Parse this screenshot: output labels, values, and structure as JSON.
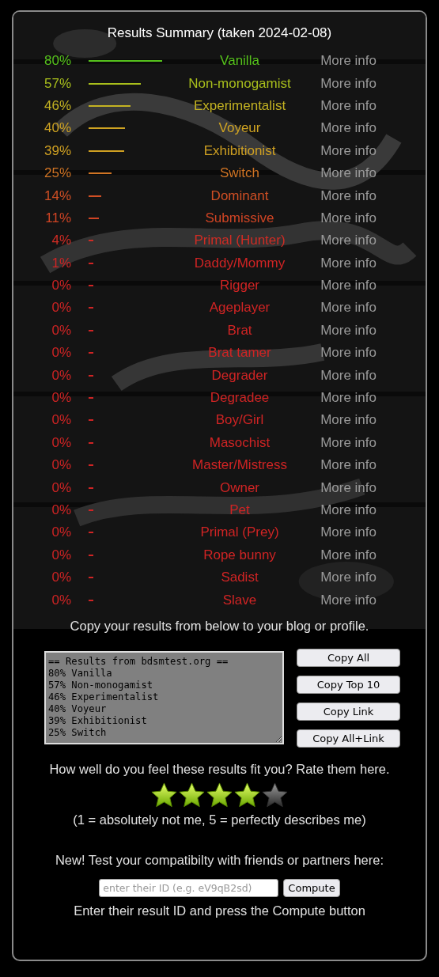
{
  "title": "Results Summary (taken 2024-02-08)",
  "results": [
    {
      "percent": "80%",
      "name": "Vanilla",
      "color": "#56c21c",
      "link": "More info"
    },
    {
      "percent": "57%",
      "name": "Non-monogamist",
      "color": "#a9bf1c",
      "link": "More info"
    },
    {
      "percent": "46%",
      "name": "Experimentalist",
      "color": "#c4b322",
      "link": "More info"
    },
    {
      "percent": "40%",
      "name": "Voyeur",
      "color": "#cfa322",
      "link": "More info"
    },
    {
      "percent": "39%",
      "name": "Exhibitionist",
      "color": "#cfa022",
      "link": "More info"
    },
    {
      "percent": "25%",
      "name": "Switch",
      "color": "#d07424",
      "link": "More info"
    },
    {
      "percent": "14%",
      "name": "Dominant",
      "color": "#d04f24",
      "link": "More info"
    },
    {
      "percent": "11%",
      "name": "Submissive",
      "color": "#d04424",
      "link": "More info"
    },
    {
      "percent": "4%",
      "name": "Primal (Hunter)",
      "color": "#d02c24",
      "link": "More info"
    },
    {
      "percent": "1%",
      "name": "Daddy/Mommy",
      "color": "#d02424",
      "link": "More info"
    },
    {
      "percent": "0%",
      "name": "Rigger",
      "color": "#d02424",
      "link": "More info"
    },
    {
      "percent": "0%",
      "name": "Ageplayer",
      "color": "#d02424",
      "link": "More info"
    },
    {
      "percent": "0%",
      "name": "Brat",
      "color": "#d02424",
      "link": "More info"
    },
    {
      "percent": "0%",
      "name": "Brat tamer",
      "color": "#d02424",
      "link": "More info"
    },
    {
      "percent": "0%",
      "name": "Degrader",
      "color": "#d02424",
      "link": "More info"
    },
    {
      "percent": "0%",
      "name": "Degradee",
      "color": "#d02424",
      "link": "More info"
    },
    {
      "percent": "0%",
      "name": "Boy/Girl",
      "color": "#d02424",
      "link": "More info"
    },
    {
      "percent": "0%",
      "name": "Masochist",
      "color": "#d02424",
      "link": "More info"
    },
    {
      "percent": "0%",
      "name": "Master/Mistress",
      "color": "#d02424",
      "link": "More info"
    },
    {
      "percent": "0%",
      "name": "Owner",
      "color": "#d02424",
      "link": "More info"
    },
    {
      "percent": "0%",
      "name": "Pet",
      "color": "#d02424",
      "link": "More info"
    },
    {
      "percent": "0%",
      "name": "Primal (Prey)",
      "color": "#d02424",
      "link": "More info"
    },
    {
      "percent": "0%",
      "name": "Rope bunny",
      "color": "#d02424",
      "link": "More info"
    },
    {
      "percent": "0%",
      "name": "Sadist",
      "color": "#d02424",
      "link": "More info"
    },
    {
      "percent": "0%",
      "name": "Slave",
      "color": "#d02424",
      "link": "More info"
    }
  ],
  "copy_prompt": "Copy your results from below to your blog or profile.",
  "results_text": "== Results from bdsmtest.org ==\n80% Vanilla\n57% Non-monogamist\n46% Experimentalist\n40% Voyeur\n39% Exhibitionist\n25% Switch",
  "copy_buttons": [
    "Copy All",
    "Copy Top 10",
    "Copy Link",
    "Copy All+Link"
  ],
  "rating_prompt": "How well do you feel these results fit you? Rate them here.",
  "rating": {
    "stars": 4
  },
  "rating_scale": "(1 = absolutely not me, 5 = perfectly describes me)",
  "compat_prompt": "New! Test your compatibilty with friends or partners here:",
  "compat_field": {
    "placeholder": "enter their ID (e.g. eV9qB2sd)"
  },
  "compute_button": "Compute",
  "compat_hint": "Enter their result ID and press the Compute button"
}
